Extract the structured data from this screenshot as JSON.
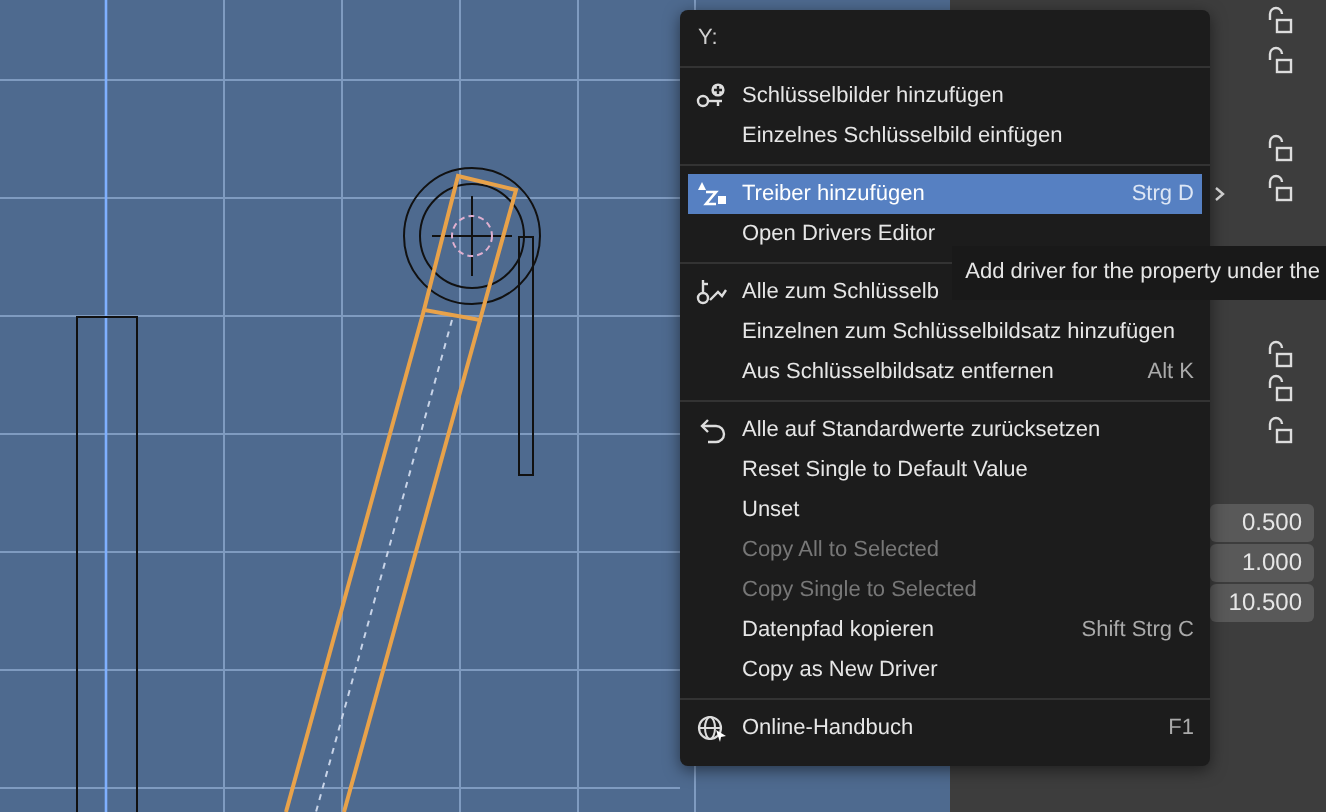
{
  "menu": {
    "title": "Y:",
    "sections": [
      {
        "items": [
          {
            "label": "Schlüsselbilder hinzufügen",
            "kind": "key-add",
            "selected": false,
            "disabled": false,
            "submenu": false
          },
          {
            "label": "Einzelnes Schlüsselbild einfügen",
            "kind": "plain",
            "selected": false,
            "disabled": false,
            "submenu": false
          }
        ]
      },
      {
        "items": [
          {
            "label": "Treiber hinzufügen",
            "kind": "driver",
            "shortcut": "Strg D",
            "selected": true,
            "disabled": false,
            "submenu": true
          },
          {
            "label": "Open Drivers Editor",
            "kind": "plain",
            "selected": false,
            "disabled": false,
            "submenu": false
          }
        ]
      },
      {
        "items": [
          {
            "label": "Alle zum Schlüsselb",
            "kind": "keyingset",
            "selected": false,
            "disabled": false,
            "submenu": false
          },
          {
            "label": "Einzelnen zum Schlüsselbildsatz hinzufügen",
            "kind": "plain",
            "selected": false,
            "disabled": false,
            "submenu": false
          },
          {
            "label": "Aus Schlüsselbildsatz entfernen",
            "kind": "plain",
            "shortcut": "Alt K",
            "selected": false,
            "disabled": false,
            "submenu": false
          }
        ]
      },
      {
        "items": [
          {
            "label": "Alle auf Standardwerte zurücksetzen",
            "kind": "undo",
            "selected": false,
            "disabled": false,
            "submenu": false
          },
          {
            "label": "Reset Single to Default Value",
            "kind": "plain",
            "selected": false,
            "disabled": false,
            "submenu": false
          },
          {
            "label": "Unset",
            "kind": "plain",
            "selected": false,
            "disabled": false,
            "submenu": false
          },
          {
            "label": "Copy All to Selected",
            "kind": "plain",
            "selected": false,
            "disabled": true,
            "submenu": false
          },
          {
            "label": "Copy Single to Selected",
            "kind": "plain",
            "selected": false,
            "disabled": true,
            "submenu": false
          },
          {
            "label": "Datenpfad kopieren",
            "kind": "plain",
            "shortcut": "Shift Strg C",
            "selected": false,
            "disabled": false,
            "submenu": false
          },
          {
            "label": "Copy as New Driver",
            "kind": "plain",
            "selected": false,
            "disabled": false,
            "submenu": false
          }
        ]
      },
      {
        "items": [
          {
            "label": "Online-Handbuch",
            "kind": "globe",
            "shortcut": "F1",
            "selected": false,
            "disabled": false,
            "submenu": false
          }
        ]
      }
    ]
  },
  "tooltip": {
    "text": "Add driver for the property under the"
  },
  "properties": {
    "values": [
      "0.500",
      "1.000",
      "10.500"
    ]
  }
}
